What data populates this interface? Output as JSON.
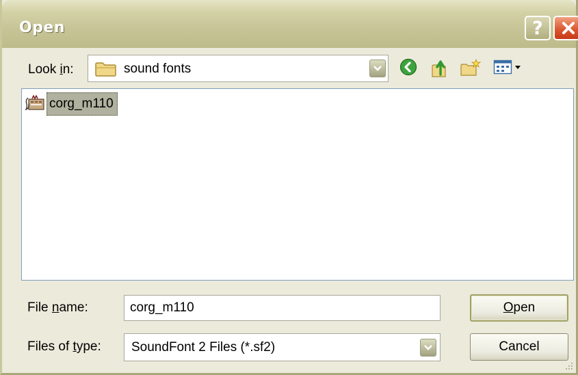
{
  "window": {
    "title": "Open"
  },
  "titlebar": {
    "help_label": "?",
    "help_icon": "question-icon",
    "close_icon": "close-x-icon"
  },
  "toolbar": {
    "lookin_label_prefix": "Look ",
    "lookin_label_accel": "i",
    "lookin_label_suffix": "n:",
    "lookin_value": "sound fonts",
    "lookin_icon": "folder-icon",
    "buttons": [
      {
        "name": "back",
        "icon": "back-arrow-icon"
      },
      {
        "name": "up-one-level",
        "icon": "folder-up-icon"
      },
      {
        "name": "create-new-folder",
        "icon": "new-folder-icon"
      },
      {
        "name": "view-menu",
        "icon": "view-menu-icon"
      }
    ]
  },
  "file_list": {
    "items": [
      {
        "label": "corg_m110",
        "icon": "soundfont-file-icon",
        "selected": true
      }
    ]
  },
  "form": {
    "filename_label_prefix": "File ",
    "filename_label_accel": "n",
    "filename_label_suffix": "ame:",
    "filename_value": "corg_m110",
    "filetype_label_prefix": "Files of ",
    "filetype_label_accel": "t",
    "filetype_label_suffix": "ype:",
    "filetype_value": "SoundFont 2 Files (*.sf2)"
  },
  "buttons": {
    "open_accel": "O",
    "open_rest": "pen",
    "cancel_label": "Cancel"
  },
  "colors": {
    "titlebar": "#c7c597",
    "dialog_background": "#eceadb",
    "selection": "#b0b19e",
    "close_button": "#d9542d",
    "list_border": "#7f9db9"
  }
}
